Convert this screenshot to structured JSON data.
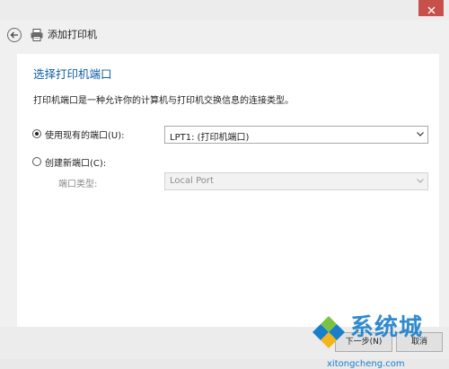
{
  "window": {
    "title": "添加打印机"
  },
  "page": {
    "heading": "选择打印机端口",
    "description": "打印机端口是一种允许你的计算机与打印机交换信息的连接类型。"
  },
  "options": {
    "use_existing_label": "使用现有的端口(U):",
    "use_existing_value": "LPT1: (打印机端口)",
    "create_new_label": "创建新端口(C):",
    "port_type_label": "端口类型:",
    "port_type_value": "Local Port"
  },
  "footer": {
    "next_label": "下一步(N)",
    "cancel_label": "取消"
  },
  "watermark": {
    "text": "系统城",
    "url": "xitongcheng.com"
  },
  "colors": {
    "heading": "#0d5fa8",
    "close": "#c7504b",
    "watermark": "#1a7fc9"
  }
}
